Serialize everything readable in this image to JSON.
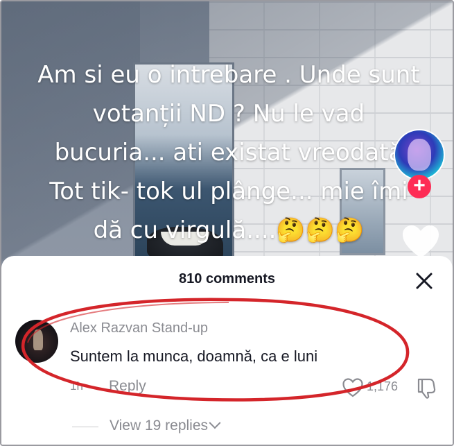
{
  "video": {
    "caption": "Am si eu o intrebare . Unde sunt\nvotanții ND ? Nu le vad\nbucuria...   ati existat vreodată\nTot tik- tok ul plânge... mie îmi\ndă cu virgulă....🤔🤔🤔",
    "follow_label": "+"
  },
  "comments_panel": {
    "title": "810 comments",
    "close_label": "✕"
  },
  "comment": {
    "author": "Alex Razvan Stand-up",
    "text": "Suntem la munca, doamnă, ca e luni",
    "time": "1h",
    "reply_label": "Reply",
    "like_count": "1,176",
    "view_replies_label": "View 19 replies"
  },
  "colors": {
    "accent": "#fe2c55",
    "highlight_ring": "#d4252a",
    "muted_text": "#8a8b91"
  }
}
